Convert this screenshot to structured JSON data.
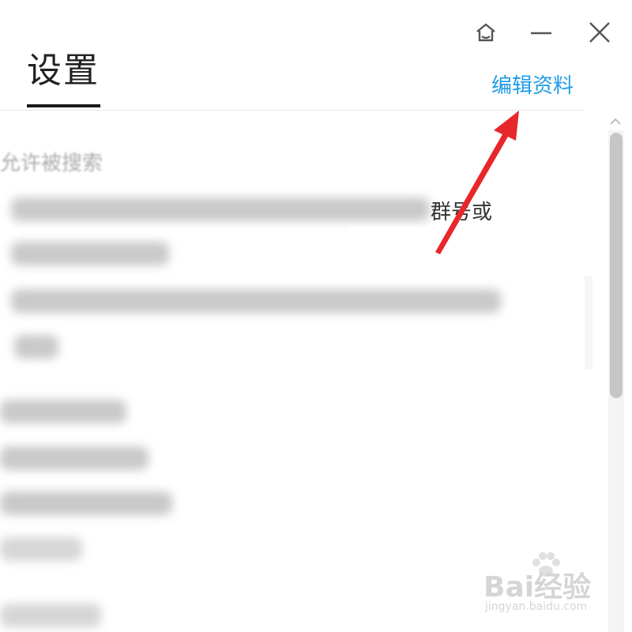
{
  "window_controls": {
    "skin_icon": "skin-house-icon",
    "minimize_icon": "minimize-icon",
    "close_icon": "close-icon"
  },
  "header": {
    "title": "设置",
    "edit_profile_link": "编辑资料",
    "link_color": "#1e9be6"
  },
  "content": {
    "partial_heading": "允许被搜索",
    "line_suffix": "群号或",
    "blurred_note": "privacy settings text is blurred in the screenshot"
  },
  "annotation": {
    "arrow_color": "#e8272b"
  },
  "scrollbar": {
    "up_icon": "chevron-up-icon"
  },
  "watermark": {
    "brand": "Bai经验",
    "sub": "jingyan.baidu.com"
  }
}
